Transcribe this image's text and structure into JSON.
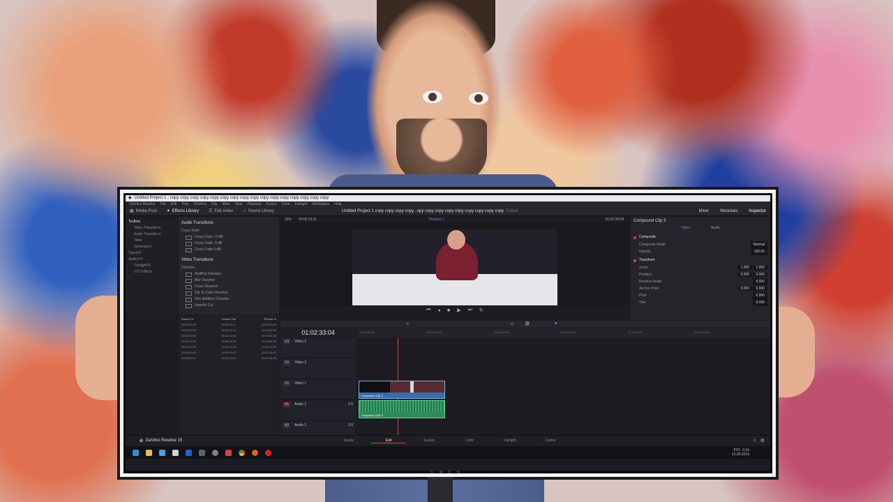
{
  "window": {
    "title": "Untitled Project 1 - copy copy copy copy copy copy copy copy copy copy copy copy copy copy copy copy"
  },
  "menus": [
    "DaVinci Resolve",
    "File",
    "Edit",
    "Trim",
    "Timeline",
    "Clip",
    "Mark",
    "View",
    "Playback",
    "Fusion",
    "Color",
    "Fairlight",
    "Workspace",
    "Help"
  ],
  "toolbar": {
    "media_pool": "Media Pool",
    "effects_library": "Effects Library",
    "edit_index": "Edit Index",
    "sound_library": "Sound Library",
    "project_title": "Untitled Project 1 copy copy copy copy...opy copy copy copy copy copy copy copy copy",
    "edited": "Edited",
    "mixer": "Mixer",
    "metadata": "Metadata",
    "inspector": "Inspector"
  },
  "toolbox": {
    "items": [
      "Toolbox",
      "Video Transitions",
      "Audio Transitions",
      "Titles",
      "Generators",
      "OpenFX",
      "Audio FX",
      "FairlightFX",
      "VST Effects"
    ]
  },
  "effects": {
    "audio_header": "Audio Transitions",
    "cross_fade": "Cross Fade",
    "audio_items": [
      "Cross Fade +3 dB",
      "Cross Fade -3 dB",
      "Cross Fade 0 dB"
    ],
    "video_header": "Video Transitions",
    "dissolve": "Dissolve",
    "video_items": [
      "Additive Dissolve",
      "Blur Dissolve",
      "Cross Dissolve",
      "Dip To Color Dissolve",
      "Non-Additive Dissolve",
      "Smooth Cut"
    ]
  },
  "viewer": {
    "zoom": "32%",
    "source_tc": "00:05:13:11",
    "timeline_name": "Timeline 1",
    "record_tc": "01:02:33:04"
  },
  "inspector": {
    "title": "Compound Clip 3",
    "tab_video": "Video",
    "tab_audio": "Audio",
    "composite": "Composite",
    "composite_mode_label": "Composite Mode",
    "composite_mode": "Normal",
    "opacity_label": "Opacity",
    "opacity": "100.00",
    "transform": "Transform",
    "zoom_label": "Zoom",
    "zoom_x": "1.000",
    "zoom_y": "1.000",
    "position_label": "Position",
    "pos_x": "0.000",
    "pos_y": "0.000",
    "rotation_label": "Rotation Angle",
    "rotation": "0.000",
    "anchor_label": "Anchor Point",
    "anchor_x": "0.000",
    "anchor_y": "0.000",
    "pitch_label": "Pitch",
    "pitch": "0.000",
    "yaw_label": "Yaw",
    "yaw": "0.000"
  },
  "timeline": {
    "timecode": "01:02:33:04",
    "ruler": [
      "01:00:00:00",
      "01:04:00:00",
      "01:08:00:00",
      "01:12:00:00",
      "01:16:00:00",
      "01:20:00:00"
    ],
    "tracks": [
      {
        "id": "V3",
        "name": "Video 3"
      },
      {
        "id": "V2",
        "name": "Video 2"
      },
      {
        "id": "V1",
        "name": "Video 1"
      },
      {
        "id": "A1",
        "name": "Audio 1",
        "level": "2.0"
      },
      {
        "id": "A2",
        "name": "Audio 2",
        "level": "2.0"
      }
    ],
    "clip_video_label": "Compound Clip 3",
    "clip_audio_label": "Compound Clip 3"
  },
  "media_pool": {
    "headers": [
      "Source In",
      "Source Out",
      "Record In"
    ],
    "rows": [
      [
        "00:00:00:00",
        "00:05:13:11",
        "01:00:00:00"
      ],
      [
        "00:00:00:00",
        "00:05:13:11",
        "01:00:00:00"
      ],
      [
        "00:00:00:00",
        "00:05:14:26",
        "01:00:54:26"
      ],
      [
        "00:00:13:22",
        "00:00:23:25",
        "01:00:54:26"
      ],
      [
        "00:00:00:00",
        "00:00:01:04",
        "01:01:00:00"
      ],
      [
        "00:00:00:00",
        "00:00:13:12",
        "01:01:14:07"
      ],
      [
        "00:00:03:11",
        "00:01:24:01",
        "01:01:54:26"
      ]
    ]
  },
  "pages": [
    "Media",
    "Edit",
    "Fusion",
    "Color",
    "Fairlight",
    "Deliver"
  ],
  "app_brand": "DaVinci Resolve 15",
  "tray": {
    "lang": "РУС",
    "time": "0:16",
    "date": "12.09.2019"
  },
  "bezel_label": "OMEN"
}
